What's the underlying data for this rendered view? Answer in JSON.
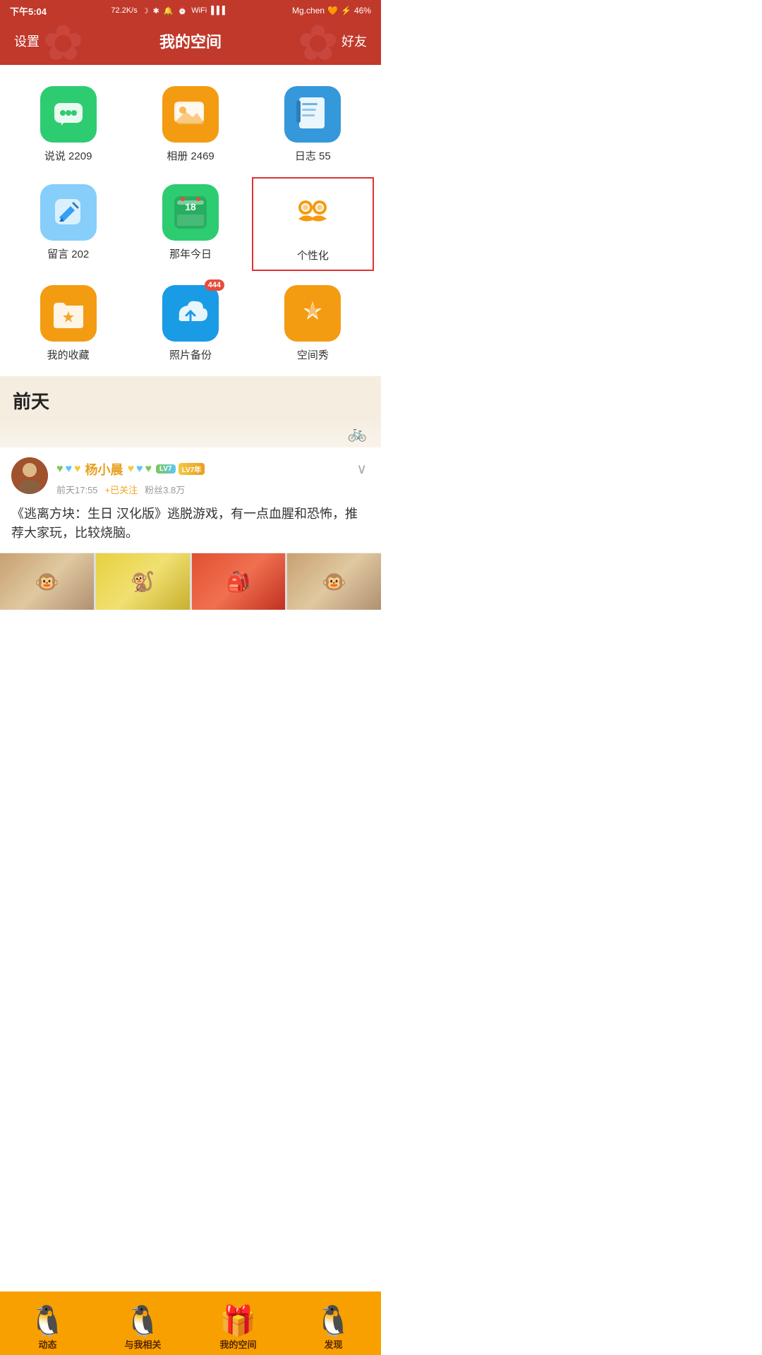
{
  "statusBar": {
    "time": "下午5:04",
    "speed": "72.2K/s",
    "user": "Mg.chen",
    "battery": "46%"
  },
  "header": {
    "left": "设置",
    "title": "我的空间",
    "right": "好友"
  },
  "icons": [
    {
      "id": "chat",
      "label": "说说 2209",
      "bg": "#2ecc71",
      "badge": null
    },
    {
      "id": "album",
      "label": "相册 2469",
      "bg": "#f39c12",
      "badge": null
    },
    {
      "id": "diary",
      "label": "日志 55",
      "bg": "#3498db",
      "badge": null
    },
    {
      "id": "note",
      "label": "留言 202",
      "bg": "#87cefa",
      "badge": null
    },
    {
      "id": "memory",
      "label": "那年今日",
      "bg": "#2ecc71",
      "badge": null
    },
    {
      "id": "personalize",
      "label": "个性化",
      "bg": "white",
      "badge": null,
      "highlighted": true
    },
    {
      "id": "collect",
      "label": "我的收藏",
      "bg": "#f39c12",
      "badge": null
    },
    {
      "id": "backup",
      "label": "照片备份",
      "bg": "#1a9be6",
      "badge": "444"
    },
    {
      "id": "space",
      "label": "空间秀",
      "bg": "#f39c12",
      "badge": null
    }
  ],
  "section": {
    "label": "前天"
  },
  "post": {
    "username": "杨小晨",
    "time": "前天17:55",
    "followText": "+已关注",
    "fans": "粉丝3.8万",
    "content": "《逃离方块：生日 汉化版》逃脱游戏，有一点血腥和恐怖，推荐大家玩，比较烧脑。"
  },
  "bottomNav": [
    {
      "id": "dynamic",
      "label": "动态"
    },
    {
      "id": "related",
      "label": "与我相关"
    },
    {
      "id": "myspace",
      "label": "我的空间"
    },
    {
      "id": "discover",
      "label": "发现"
    }
  ]
}
